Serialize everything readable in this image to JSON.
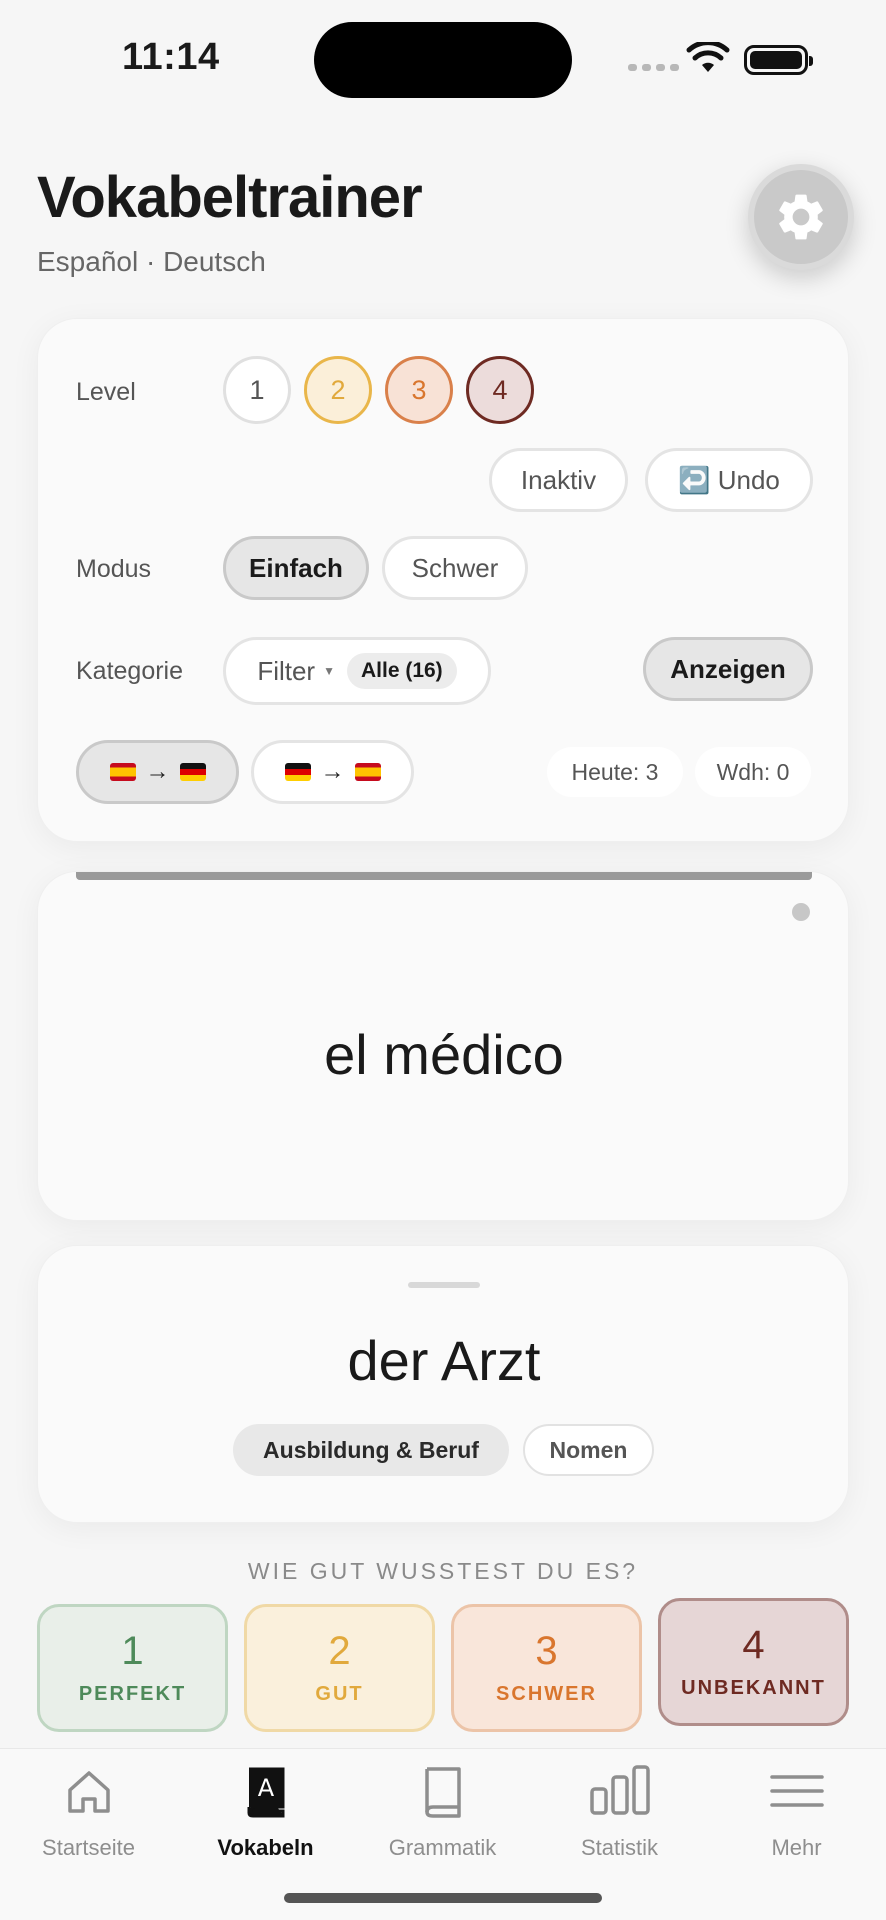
{
  "status_bar": {
    "time": "11:14"
  },
  "header": {
    "title": "Vokabeltrainer",
    "subtitle": "Español · Deutsch"
  },
  "controls": {
    "level_label": "Level",
    "levels": [
      "1",
      "2",
      "3",
      "4"
    ],
    "inactive_label": "Inaktiv",
    "undo_label": "↩️ Undo",
    "mode_label": "Modus",
    "mode_easy": "Einfach",
    "mode_hard": "Schwer",
    "category_label": "Kategorie",
    "filter_label": "Filter",
    "filter_value": "Alle (16)",
    "show_label": "Anzeigen",
    "today_label": "Heute: 3",
    "repeat_label": "Wdh: 0"
  },
  "flashcard": {
    "front_word": "el médico",
    "back_word": "der Arzt",
    "category_tag": "Ausbildung & Beruf",
    "type_tag": "Nomen",
    "progress": 1.0
  },
  "rating": {
    "question": "WIE GUT WUSSTEST DU ES?",
    "buttons": [
      {
        "num": "1",
        "label": "PERFEKT"
      },
      {
        "num": "2",
        "label": "GUT"
      },
      {
        "num": "3",
        "label": "SCHWER"
      },
      {
        "num": "4",
        "label": "UNBEKANNT"
      }
    ]
  },
  "tabs": [
    {
      "label": "Startseite",
      "icon": "house-icon"
    },
    {
      "label": "Vokabeln",
      "icon": "vocab-book-icon"
    },
    {
      "label": "Grammatik",
      "icon": "book-icon"
    },
    {
      "label": "Statistik",
      "icon": "bar-chart-icon"
    },
    {
      "label": "Mehr",
      "icon": "menu-icon"
    }
  ],
  "colors": {
    "level2": "#e9b64a",
    "level3": "#d9804a",
    "level4": "#6e2a22",
    "perfekt": "#4e8a5a",
    "gut": "#e1a93c",
    "schwer": "#d9762e",
    "unbekannt": "#6e2a22"
  }
}
